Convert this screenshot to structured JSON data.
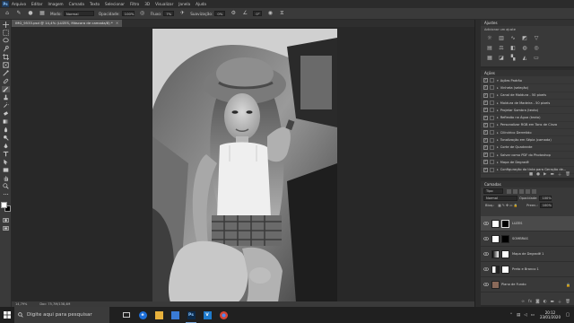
{
  "menubar": {
    "app_icon": "Ps",
    "items": [
      "Arquivo",
      "Editar",
      "Imagem",
      "Camada",
      "Texto",
      "Selecionar",
      "Filtro",
      "3D",
      "Visualizar",
      "Janela",
      "Ajuda"
    ]
  },
  "options": {
    "tool_icon": "brush-icon",
    "mode_label": "Modo:",
    "mode_value": "Normal",
    "opacity_label": "Opacidade:",
    "opacity_value": "100%",
    "flow_label": "Fluxo:",
    "flow_value": "7%",
    "smoothing_label": "Suavização:",
    "smoothing_value": "0%",
    "angle_value": "0°"
  },
  "document": {
    "tab_label": "IMG_9533.psd @ 14,4% (LUZES, Máscara de camada/8) *"
  },
  "status": {
    "zoom": "14,79%",
    "doc": "Doc: 75,7M/138,4M"
  },
  "panels": {
    "ajustes": {
      "title": "Ajustes",
      "hint": "Adicionar um ajuste",
      "icons": [
        "sun-icon",
        "levels-icon",
        "curves-icon",
        "exposure-icon",
        "triangle-icon",
        "vibrance-icon",
        "hue-icon",
        "balance-icon",
        "bw-icon",
        "camera-icon",
        "mixer-icon",
        "lookup-icon",
        "invert-icon",
        "posterize-icon",
        "threshold-icon"
      ]
    },
    "acoes": {
      "title": "Ações",
      "items": [
        {
          "label": "Ações Padrão",
          "checked": true
        },
        {
          "label": "Vinheta (seleção)",
          "checked": true
        },
        {
          "label": "Canal de Moldura - 50 pixels",
          "checked": true
        },
        {
          "label": "Moldura de Madeira - 50 pixels",
          "checked": true
        },
        {
          "label": "Projetar Sombra (texto)",
          "checked": true
        },
        {
          "label": "Reflexão na Água (texto)",
          "checked": true
        },
        {
          "label": "Personalizar RGB em Tons de Cinza",
          "checked": true
        },
        {
          "label": "Cilíndrico Derretido",
          "checked": true
        },
        {
          "label": "Tonalização em Sépia (camada)",
          "checked": true
        },
        {
          "label": "Corte de Quadrante",
          "checked": true
        },
        {
          "label": "Salvar como PDF do Photoshop",
          "checked": true
        },
        {
          "label": "Mapa de Degradê",
          "checked": true
        },
        {
          "label": "Configuração da tinta para Geração de...",
          "checked": true
        }
      ]
    },
    "camadas": {
      "title": "Camadas",
      "filter_label": "Tipo",
      "mode": "Normal",
      "opacity_label": "Opacidade:",
      "opacity_value": "100%",
      "lock_label": "Bloq.:",
      "fill_label": "Preen.:",
      "fill_value": "100%",
      "layers": [
        {
          "name": "LUZES",
          "selected": true,
          "thumb": "#ffffff",
          "mask": "#000000",
          "locked": false
        },
        {
          "name": "SOMBRAS",
          "selected": false,
          "thumb": "#ffffff",
          "mask": "#000000",
          "locked": false
        },
        {
          "name": "Mapa de Degradê 1",
          "selected": false,
          "thumb": "#e8e8e8",
          "mask": "#ffffff",
          "locked": false
        },
        {
          "name": "Preto e Branco 1",
          "selected": false,
          "thumb": "#d8d8d8",
          "mask": "#ffffff",
          "locked": false
        },
        {
          "name": "Plano de Fundo",
          "selected": false,
          "thumb": "#8a6a5a",
          "mask": null,
          "locked": true
        }
      ]
    }
  },
  "taskbar": {
    "search_placeholder": "Digite aqui para pesquisar",
    "apps": [
      {
        "name": "task-view",
        "glyph": "▭",
        "color": "#2b2b2b",
        "active": false
      },
      {
        "name": "edge",
        "glyph": "e",
        "color": "#1e6fd9",
        "active": false
      },
      {
        "name": "file-explorer",
        "glyph": "▬",
        "color": "#e8b13c",
        "active": false
      },
      {
        "name": "store",
        "glyph": "▣",
        "color": "#3a7bd5",
        "active": false
      },
      {
        "name": "photoshop",
        "glyph": "Ps",
        "color": "#0c2a4a",
        "active": true
      },
      {
        "name": "vscode",
        "glyph": "V",
        "color": "#1e7acc",
        "active": false
      },
      {
        "name": "chrome",
        "glyph": "●",
        "color": "#d64535",
        "active": false
      }
    ],
    "time": "20:12",
    "date": "23/01/2020"
  }
}
